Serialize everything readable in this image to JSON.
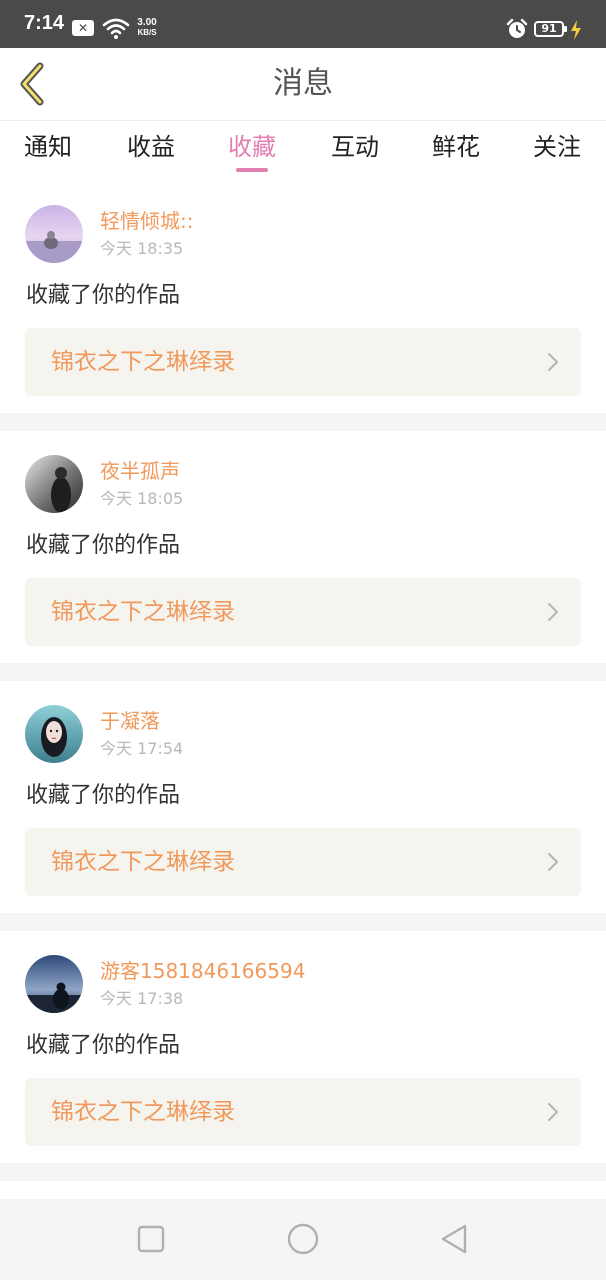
{
  "status_bar": {
    "time": "7:14",
    "x_icon": "notification-x-icon",
    "wifi_icon": "wifi-icon",
    "speed_value": "3.00",
    "speed_unit": "KB/S",
    "alarm_icon": "alarm-clock-icon",
    "battery": "91",
    "charging_icon": "lightning-bolt-icon"
  },
  "header": {
    "title": "消息",
    "back_icon": "chevron-left-icon"
  },
  "tabs": [
    {
      "label": "通知",
      "active": false
    },
    {
      "label": "收益",
      "active": false
    },
    {
      "label": "收藏",
      "active": true
    },
    {
      "label": "互动",
      "active": false
    },
    {
      "label": "鲜花",
      "active": false
    },
    {
      "label": "关注",
      "active": false
    }
  ],
  "cards": [
    {
      "username": "轻情倾城::",
      "time": "今天 18:35",
      "action": "收藏了你的作品",
      "work_title": "锦衣之下之琳绎录"
    },
    {
      "username": "夜半孤声",
      "time": "今天 18:05",
      "action": "收藏了你的作品",
      "work_title": "锦衣之下之琳绎录"
    },
    {
      "username": "于凝落",
      "time": "今天 17:54",
      "action": "收藏了你的作品",
      "work_title": "锦衣之下之琳绎录"
    },
    {
      "username": "游客1581846166594",
      "time": "今天 17:38",
      "action": "收藏了你的作品",
      "work_title": "锦衣之下之琳绎录"
    }
  ],
  "nav_bar": {
    "recent_icon": "square-recents-icon",
    "home_icon": "circle-home-icon",
    "back_icon": "triangle-back-icon"
  },
  "colors": {
    "accent_pink": "#e27fb0",
    "username_orange": "#f0995b",
    "status_bar_bg": "#4a4a4a",
    "work_card_bg": "#f5f4ef"
  }
}
